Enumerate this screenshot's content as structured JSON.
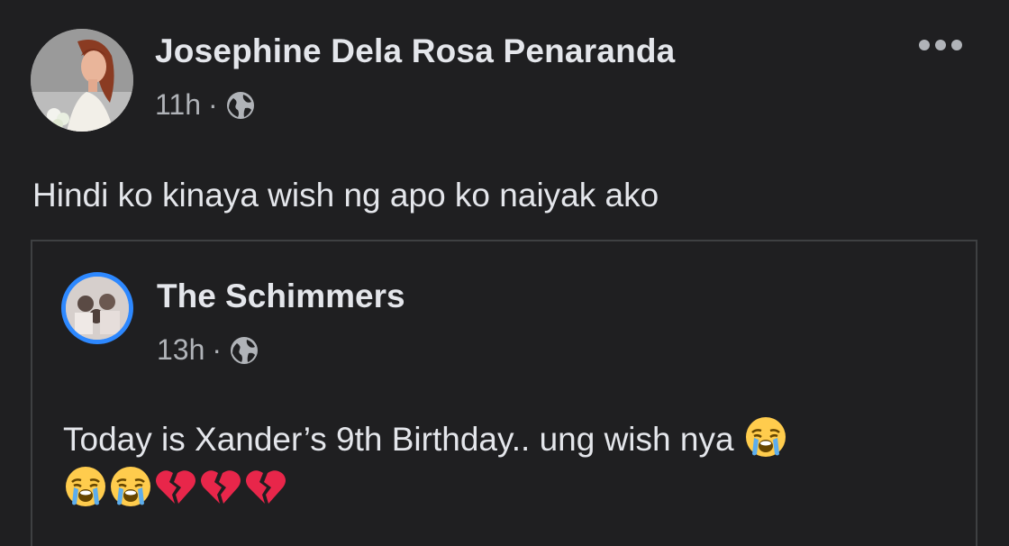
{
  "post": {
    "author": "Josephine Dela Rosa Penaranda",
    "time": "11h",
    "separator": "·",
    "privacy_icon": "globe-icon",
    "menu_icon": "more-options-icon",
    "text": "Hindi ko kinaya wish ng apo ko naiyak ako"
  },
  "shared_post": {
    "author": "The Schimmers",
    "time": "13h",
    "separator": "·",
    "privacy_icon": "globe-icon",
    "text": "Today is Xander’s 9th Birthday.. ung wish nya",
    "emojis": [
      "crying-face-emoji",
      "crying-face-emoji",
      "crying-face-emoji",
      "broken-heart-emoji",
      "broken-heart-emoji",
      "broken-heart-emoji"
    ]
  },
  "colors": {
    "background": "#1f1f21",
    "text_primary": "#e4e6eb",
    "text_secondary": "#b0b3b8",
    "story_ring": "#2d88ff",
    "broken_heart": "#e8264a"
  }
}
